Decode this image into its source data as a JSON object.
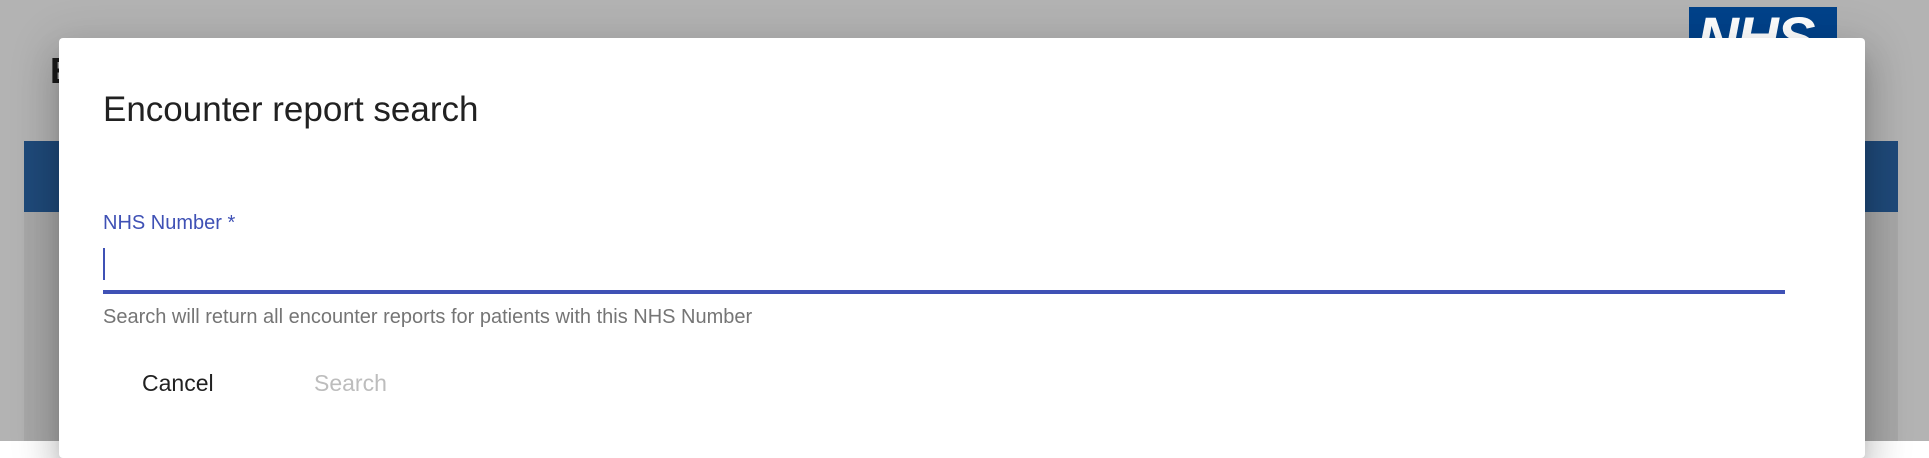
{
  "background": {
    "heading_letter": "E",
    "logo_text": "NHS"
  },
  "dialog": {
    "title": "Encounter report search",
    "field": {
      "label": "NHS Number *",
      "value": "",
      "hint": "Search will return all encounter reports for patients with this NHS Number"
    },
    "actions": {
      "cancel_label": "Cancel",
      "search_label": "Search",
      "search_disabled": true
    }
  },
  "colors": {
    "accent": "#3f51b5",
    "nav_bar": "#1f4a7a",
    "nhs_blue": "#00428a",
    "disabled_text": "#bdbdbd",
    "hint_text": "#757575"
  }
}
